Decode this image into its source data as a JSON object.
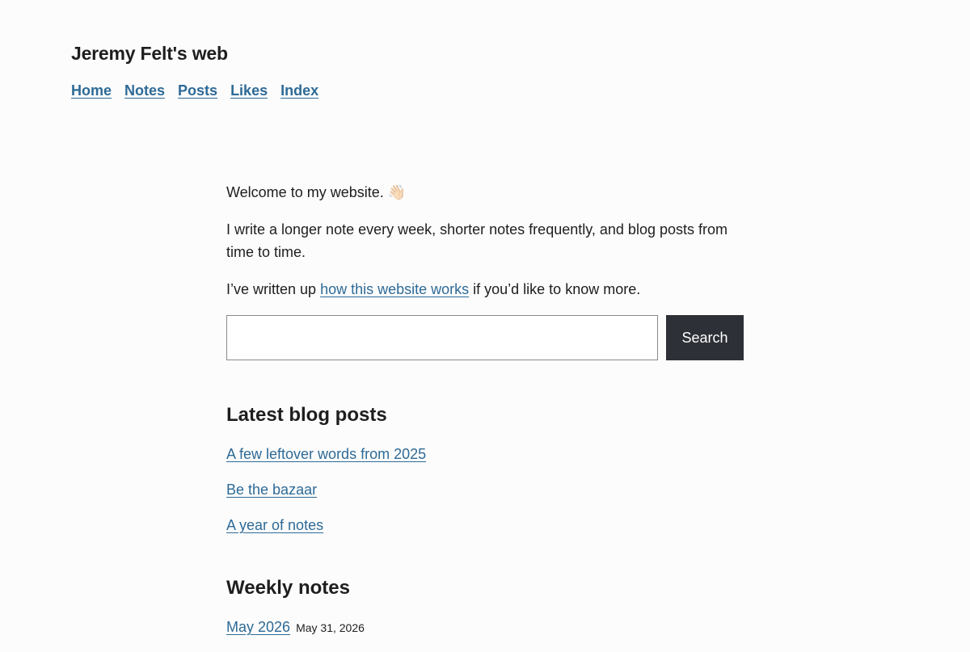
{
  "site": {
    "title": "Jeremy Felt's web"
  },
  "nav": {
    "items": [
      {
        "label": "Home"
      },
      {
        "label": "Notes"
      },
      {
        "label": "Posts"
      },
      {
        "label": "Likes"
      },
      {
        "label": "Index"
      }
    ]
  },
  "intro": {
    "welcome": "Welcome to my website.",
    "wave_emoji": "👋🏻",
    "paragraph": "I write a longer note every week, shorter notes frequently, and blog posts from time to time.",
    "works_before": "I’ve written up ",
    "works_link": "how this website works",
    "works_after": " if you’d like to know more."
  },
  "search": {
    "value": "",
    "placeholder": "",
    "button_label": "Search"
  },
  "blog": {
    "heading": "Latest blog posts",
    "posts": [
      {
        "title": "A few leftover words from 2025"
      },
      {
        "title": "Be the bazaar"
      },
      {
        "title": "A year of notes"
      }
    ]
  },
  "weekly": {
    "heading": "Weekly notes",
    "notes": [
      {
        "title": "May 2026",
        "date": "May 31, 2026"
      }
    ]
  },
  "colors": {
    "link": "#2e6a96",
    "button_bg": "#2d3036",
    "background": "#fcfcfc",
    "text": "#1e1e1e"
  }
}
